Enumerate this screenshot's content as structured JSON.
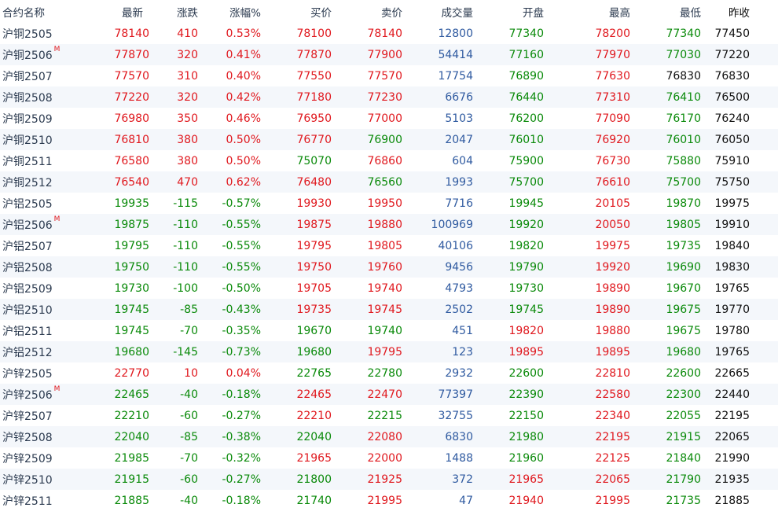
{
  "headers": [
    "合约名称",
    "最新",
    "涨跌",
    "涨幅%",
    "买价",
    "卖价",
    "成交量",
    "开盘",
    "最高",
    "最低",
    "昨收"
  ],
  "colors": {
    "up": "#e0181e",
    "down": "#0a8a0a",
    "volume": "#2f5aa0"
  },
  "rows": [
    {
      "name": "沪铜2505",
      "main": "",
      "last": "78140",
      "chg": "410",
      "pct": "0.53%",
      "bid": "78100",
      "ask": "78140",
      "vol": "12800",
      "open": "77340",
      "high": "78200",
      "low": "77340",
      "prev": "77450",
      "cls": [
        "up",
        "up",
        "up",
        "up",
        "up",
        "vol",
        "down",
        "up",
        "down"
      ]
    },
    {
      "name": "沪铜2506",
      "main": "M",
      "last": "77870",
      "chg": "320",
      "pct": "0.41%",
      "bid": "77870",
      "ask": "77900",
      "vol": "54414",
      "open": "77160",
      "high": "77970",
      "low": "77030",
      "prev": "77220",
      "cls": [
        "up",
        "up",
        "up",
        "up",
        "up",
        "vol",
        "down",
        "up",
        "down"
      ]
    },
    {
      "name": "沪铜2507",
      "main": "",
      "last": "77570",
      "chg": "310",
      "pct": "0.40%",
      "bid": "77550",
      "ask": "77570",
      "vol": "17754",
      "open": "76890",
      "high": "77630",
      "low": "76830",
      "prev": "76830",
      "cls": [
        "up",
        "up",
        "up",
        "up",
        "up",
        "vol",
        "down",
        "up",
        "flat"
      ]
    },
    {
      "name": "沪铜2508",
      "main": "",
      "last": "77220",
      "chg": "320",
      "pct": "0.42%",
      "bid": "77180",
      "ask": "77230",
      "vol": "6676",
      "open": "76440",
      "high": "77310",
      "low": "76410",
      "prev": "76500",
      "cls": [
        "up",
        "up",
        "up",
        "up",
        "up",
        "vol",
        "down",
        "up",
        "down"
      ]
    },
    {
      "name": "沪铜2509",
      "main": "",
      "last": "76980",
      "chg": "350",
      "pct": "0.46%",
      "bid": "76950",
      "ask": "77000",
      "vol": "5103",
      "open": "76200",
      "high": "77090",
      "low": "76170",
      "prev": "76240",
      "cls": [
        "up",
        "up",
        "up",
        "up",
        "up",
        "vol",
        "down",
        "up",
        "down"
      ]
    },
    {
      "name": "沪铜2510",
      "main": "",
      "last": "76810",
      "chg": "380",
      "pct": "0.50%",
      "bid": "76770",
      "ask": "76900",
      "vol": "2047",
      "open": "76010",
      "high": "76920",
      "low": "76010",
      "prev": "76050",
      "cls": [
        "up",
        "up",
        "up",
        "up",
        "down",
        "vol",
        "down",
        "up",
        "down"
      ]
    },
    {
      "name": "沪铜2511",
      "main": "",
      "last": "76580",
      "chg": "380",
      "pct": "0.50%",
      "bid": "75070",
      "ask": "76860",
      "vol": "604",
      "open": "75900",
      "high": "76730",
      "low": "75880",
      "prev": "75910",
      "cls": [
        "up",
        "up",
        "up",
        "down",
        "up",
        "vol",
        "down",
        "up",
        "down"
      ]
    },
    {
      "name": "沪铜2512",
      "main": "",
      "last": "76540",
      "chg": "470",
      "pct": "0.62%",
      "bid": "76480",
      "ask": "76560",
      "vol": "1993",
      "open": "75700",
      "high": "76610",
      "low": "75700",
      "prev": "75750",
      "cls": [
        "up",
        "up",
        "up",
        "up",
        "down",
        "vol",
        "down",
        "up",
        "down"
      ]
    },
    {
      "name": "沪铝2505",
      "main": "",
      "last": "19935",
      "chg": "-115",
      "pct": "-0.57%",
      "bid": "19930",
      "ask": "19950",
      "vol": "7716",
      "open": "19945",
      "high": "20105",
      "low": "19870",
      "prev": "19975",
      "cls": [
        "down",
        "down",
        "down",
        "up",
        "up",
        "vol",
        "down",
        "up",
        "down"
      ]
    },
    {
      "name": "沪铝2506",
      "main": "M",
      "last": "19875",
      "chg": "-110",
      "pct": "-0.55%",
      "bid": "19875",
      "ask": "19880",
      "vol": "100969",
      "open": "19920",
      "high": "20050",
      "low": "19805",
      "prev": "19910",
      "cls": [
        "down",
        "down",
        "down",
        "up",
        "up",
        "vol",
        "down",
        "up",
        "down"
      ]
    },
    {
      "name": "沪铝2507",
      "main": "",
      "last": "19795",
      "chg": "-110",
      "pct": "-0.55%",
      "bid": "19795",
      "ask": "19805",
      "vol": "40106",
      "open": "19820",
      "high": "19975",
      "low": "19735",
      "prev": "19840",
      "cls": [
        "down",
        "down",
        "down",
        "up",
        "up",
        "vol",
        "down",
        "up",
        "down"
      ]
    },
    {
      "name": "沪铝2508",
      "main": "",
      "last": "19750",
      "chg": "-110",
      "pct": "-0.55%",
      "bid": "19750",
      "ask": "19760",
      "vol": "9456",
      "open": "19790",
      "high": "19920",
      "low": "19690",
      "prev": "19830",
      "cls": [
        "down",
        "down",
        "down",
        "up",
        "up",
        "vol",
        "down",
        "up",
        "down"
      ]
    },
    {
      "name": "沪铝2509",
      "main": "",
      "last": "19730",
      "chg": "-100",
      "pct": "-0.50%",
      "bid": "19705",
      "ask": "19740",
      "vol": "4793",
      "open": "19730",
      "high": "19890",
      "low": "19670",
      "prev": "19765",
      "cls": [
        "down",
        "down",
        "down",
        "up",
        "up",
        "vol",
        "down",
        "up",
        "down"
      ]
    },
    {
      "name": "沪铝2510",
      "main": "",
      "last": "19745",
      "chg": "-85",
      "pct": "-0.43%",
      "bid": "19735",
      "ask": "19745",
      "vol": "2502",
      "open": "19745",
      "high": "19890",
      "low": "19675",
      "prev": "19770",
      "cls": [
        "down",
        "down",
        "down",
        "up",
        "up",
        "vol",
        "down",
        "up",
        "down"
      ]
    },
    {
      "name": "沪铝2511",
      "main": "",
      "last": "19745",
      "chg": "-70",
      "pct": "-0.35%",
      "bid": "19670",
      "ask": "19740",
      "vol": "451",
      "open": "19820",
      "high": "19880",
      "low": "19675",
      "prev": "19780",
      "cls": [
        "down",
        "down",
        "down",
        "down",
        "down",
        "vol",
        "up",
        "up",
        "down"
      ]
    },
    {
      "name": "沪铝2512",
      "main": "",
      "last": "19680",
      "chg": "-145",
      "pct": "-0.73%",
      "bid": "19680",
      "ask": "19795",
      "vol": "123",
      "open": "19895",
      "high": "19895",
      "low": "19680",
      "prev": "19765",
      "cls": [
        "down",
        "down",
        "down",
        "down",
        "up",
        "vol",
        "up",
        "up",
        "down"
      ]
    },
    {
      "name": "沪锌2505",
      "main": "",
      "last": "22770",
      "chg": "10",
      "pct": "0.04%",
      "bid": "22765",
      "ask": "22780",
      "vol": "2932",
      "open": "22600",
      "high": "22810",
      "low": "22600",
      "prev": "22665",
      "cls": [
        "up",
        "up",
        "up",
        "down",
        "down",
        "vol",
        "down",
        "up",
        "down"
      ]
    },
    {
      "name": "沪锌2506",
      "main": "M",
      "last": "22465",
      "chg": "-40",
      "pct": "-0.18%",
      "bid": "22465",
      "ask": "22470",
      "vol": "77397",
      "open": "22390",
      "high": "22580",
      "low": "22300",
      "prev": "22440",
      "cls": [
        "down",
        "down",
        "down",
        "up",
        "up",
        "vol",
        "down",
        "up",
        "down"
      ]
    },
    {
      "name": "沪锌2507",
      "main": "",
      "last": "22210",
      "chg": "-60",
      "pct": "-0.27%",
      "bid": "22210",
      "ask": "22215",
      "vol": "32755",
      "open": "22150",
      "high": "22340",
      "low": "22055",
      "prev": "22195",
      "cls": [
        "down",
        "down",
        "down",
        "up",
        "down",
        "vol",
        "down",
        "up",
        "down"
      ]
    },
    {
      "name": "沪锌2508",
      "main": "",
      "last": "22040",
      "chg": "-85",
      "pct": "-0.38%",
      "bid": "22040",
      "ask": "22080",
      "vol": "6830",
      "open": "21980",
      "high": "22195",
      "low": "21915",
      "prev": "22065",
      "cls": [
        "down",
        "down",
        "down",
        "down",
        "up",
        "vol",
        "down",
        "up",
        "down"
      ]
    },
    {
      "name": "沪锌2509",
      "main": "",
      "last": "21985",
      "chg": "-70",
      "pct": "-0.32%",
      "bid": "21965",
      "ask": "22000",
      "vol": "1488",
      "open": "21960",
      "high": "22125",
      "low": "21840",
      "prev": "21990",
      "cls": [
        "down",
        "down",
        "down",
        "up",
        "up",
        "vol",
        "down",
        "up",
        "down"
      ]
    },
    {
      "name": "沪锌2510",
      "main": "",
      "last": "21915",
      "chg": "-60",
      "pct": "-0.27%",
      "bid": "21800",
      "ask": "21925",
      "vol": "372",
      "open": "21965",
      "high": "22065",
      "low": "21790",
      "prev": "21935",
      "cls": [
        "down",
        "down",
        "down",
        "down",
        "up",
        "vol",
        "up",
        "up",
        "down"
      ]
    },
    {
      "name": "沪锌2511",
      "main": "",
      "last": "21885",
      "chg": "-40",
      "pct": "-0.18%",
      "bid": "21740",
      "ask": "21995",
      "vol": "47",
      "open": "21940",
      "high": "21995",
      "low": "21735",
      "prev": "21885",
      "cls": [
        "down",
        "down",
        "down",
        "down",
        "up",
        "vol",
        "up",
        "up",
        "down"
      ]
    }
  ]
}
